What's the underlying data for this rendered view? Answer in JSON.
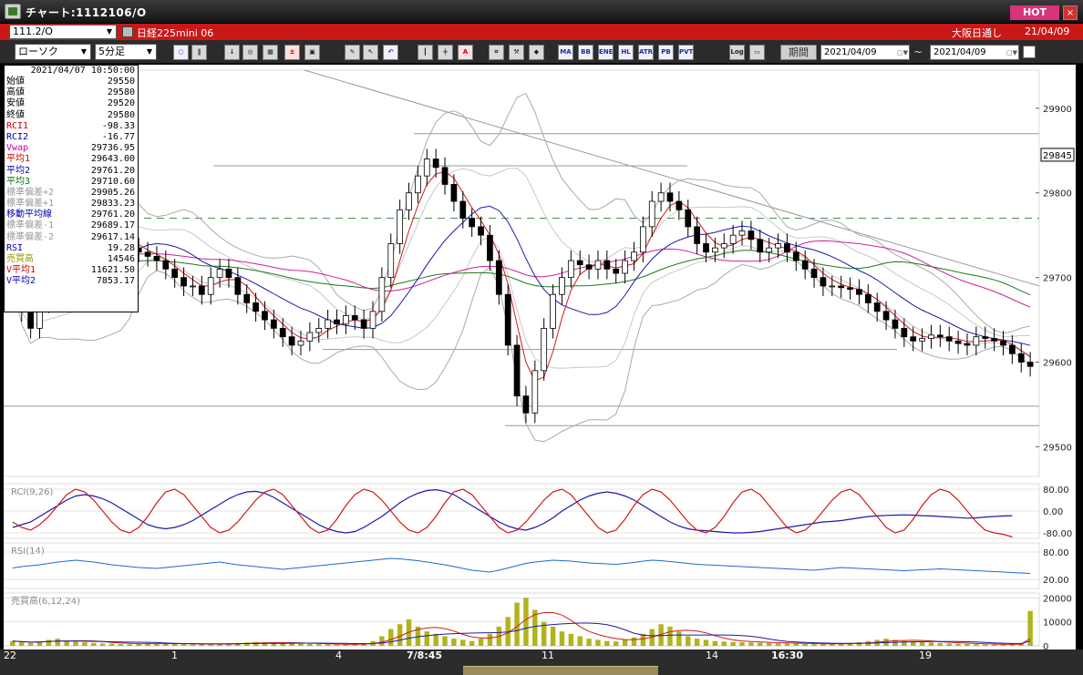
{
  "window": {
    "title": "チャート:1112106/O",
    "hot_label": "HOT",
    "close_label": "×"
  },
  "symbol_bar": {
    "symbol": "111.2/O",
    "instrument": "日経225mini 06",
    "session": "大阪日通し",
    "date_short": "21/04/09"
  },
  "toolbar": {
    "chart_type": "ローソク",
    "interval": "5分足",
    "buttons": [
      "MA",
      "BB",
      "ENE",
      "HL",
      "ATR",
      "PB",
      "PVT",
      "Log"
    ],
    "period_label": "期間",
    "date_from": "2021/04/09",
    "date_to": "2021/04/09",
    "tilde": "~"
  },
  "info": {
    "datetime": "2021/04/07  10:50:00",
    "rows": [
      {
        "label": "始値",
        "value": "29550",
        "color": "#000000"
      },
      {
        "label": "高値",
        "value": "29580",
        "color": "#000000"
      },
      {
        "label": "安値",
        "value": "29520",
        "color": "#000000"
      },
      {
        "label": "終値",
        "value": "29580",
        "color": "#000000"
      },
      {
        "label": "RCI1",
        "value": "-98.33",
        "color": "#cc0000"
      },
      {
        "label": "RCI2",
        "value": "-16.77",
        "color": "#0000aa"
      },
      {
        "label": "Vwap",
        "value": "29736.95",
        "color": "#cc00aa"
      },
      {
        "label": "平均1",
        "value": "29643.00",
        "color": "#cc0000"
      },
      {
        "label": "平均2",
        "value": "29761.20",
        "color": "#0000aa"
      },
      {
        "label": "平均3",
        "value": "29710.60",
        "color": "#007700"
      },
      {
        "label": "標準偏差+2",
        "value": "29905.26",
        "color": "#999999"
      },
      {
        "label": "標準偏差+1",
        "value": "29833.23",
        "color": "#999999"
      },
      {
        "label": "移動平均線",
        "value": "29761.20",
        "color": "#0000aa"
      },
      {
        "label": "標準偏差-1",
        "value": "29689.17",
        "color": "#999999"
      },
      {
        "label": "標準偏差-2",
        "value": "29617.14",
        "color": "#999999"
      },
      {
        "label": "RSI",
        "value": "19.28",
        "color": "#0000aa"
      },
      {
        "label": "売買高",
        "value": "14546",
        "color": "#999900"
      },
      {
        "label": "V平均1",
        "value": "11621.50",
        "color": "#cc0000"
      },
      {
        "label": "V平均2",
        "value": "7853.17",
        "color": "#0000aa"
      }
    ]
  },
  "axes": {
    "price_ticks": [
      "29900",
      "29800",
      "29700",
      "29600",
      "29500"
    ],
    "current_price": "29845",
    "rci_label": "RCI(9,26)",
    "rci_ticks": [
      "80.00",
      "0.00",
      "-80.00"
    ],
    "rsi_label": "RSI(14)",
    "rsi_ticks": [
      "80.00",
      "20.00"
    ],
    "vol_label": "売買高(6,12,24)",
    "vol_ticks": [
      "20000",
      "10000",
      "0"
    ],
    "x_ticks": [
      {
        "label": "22",
        "bold": false
      },
      {
        "label": "1",
        "bold": false
      },
      {
        "label": "4",
        "bold": false
      },
      {
        "label": "7/8:45",
        "bold": true
      },
      {
        "label": "11",
        "bold": false
      },
      {
        "label": "14",
        "bold": false
      },
      {
        "label": "16:30",
        "bold": true
      },
      {
        "label": "19",
        "bold": false
      }
    ]
  },
  "chart_data": {
    "type": "candlestick",
    "price_range": [
      29465,
      29945
    ],
    "close": [
      29690,
      29660,
      29640,
      29670,
      29700,
      29720,
      29730,
      29740,
      29760,
      29770,
      29760,
      29750,
      29740,
      29735,
      29730,
      29725,
      29720,
      29710,
      29700,
      29690,
      29690,
      29680,
      29700,
      29710,
      29700,
      29680,
      29670,
      29660,
      29650,
      29640,
      29630,
      29620,
      29625,
      29635,
      29640,
      29650,
      29645,
      29655,
      29650,
      29640,
      29660,
      29700,
      29740,
      29780,
      29800,
      29820,
      29840,
      29830,
      29810,
      29790,
      29770,
      29760,
      29750,
      29720,
      29680,
      29620,
      29560,
      29540,
      29590,
      29640,
      29680,
      29700,
      29720,
      29715,
      29710,
      29720,
      29710,
      29705,
      29720,
      29730,
      29760,
      29790,
      29800,
      29790,
      29780,
      29760,
      29740,
      29730,
      29735,
      29740,
      29750,
      29755,
      29745,
      29730,
      29735,
      29740,
      29730,
      29720,
      29710,
      29700,
      29690,
      29690,
      29688,
      29686,
      29680,
      29670,
      29660,
      29650,
      29640,
      29630,
      29625,
      29628,
      29632,
      29630,
      29625,
      29622,
      29620,
      29630,
      29628,
      29625,
      29620,
      29610,
      29600,
      29595
    ],
    "rci1": [
      -40,
      -60,
      -70,
      -50,
      -20,
      20,
      60,
      80,
      70,
      40,
      0,
      -40,
      -70,
      -80,
      -60,
      -20,
      30,
      70,
      80,
      60,
      20,
      -20,
      -60,
      -80,
      -70,
      -40,
      0,
      40,
      70,
      80,
      60,
      20,
      -20,
      -60,
      -80,
      -70,
      -30,
      20,
      60,
      80,
      70,
      40,
      0,
      -40,
      -70,
      -80,
      -60,
      -20,
      30,
      70,
      80,
      60,
      20,
      -20,
      -60,
      -80,
      -70,
      -40,
      0,
      40,
      70,
      80,
      60,
      20,
      -20,
      -60,
      -80,
      -70,
      -30,
      20,
      60,
      80,
      70,
      40,
      0,
      -40,
      -70,
      -80,
      -60,
      -20,
      30,
      70,
      80,
      60,
      20,
      -20,
      -60,
      -80,
      -70,
      -40,
      0,
      40,
      70,
      80,
      60,
      20,
      -20,
      -60,
      -80,
      -70,
      -30,
      20,
      60,
      80,
      70,
      40,
      0,
      -40,
      -70,
      -80,
      -85,
      -95
    ],
    "rci2": [
      -60,
      -50,
      -40,
      -20,
      0,
      20,
      40,
      55,
      60,
      55,
      45,
      30,
      10,
      -10,
      -30,
      -50,
      -60,
      -65,
      -60,
      -50,
      -35,
      -15,
      5,
      25,
      45,
      60,
      70,
      72,
      65,
      50,
      30,
      10,
      -10,
      -30,
      -50,
      -65,
      -75,
      -80,
      -75,
      -60,
      -40,
      -20,
      5,
      30,
      50,
      65,
      75,
      78,
      72,
      60,
      40,
      20,
      0,
      -20,
      -40,
      -55,
      -65,
      -70,
      -60,
      -45,
      -25,
      0,
      20,
      40,
      55,
      65,
      70,
      65,
      55,
      40,
      20,
      0,
      -20,
      -40,
      -55,
      -65,
      -70,
      -72,
      -75,
      -78,
      -80,
      -80,
      -78,
      -75,
      -70,
      -65,
      -60,
      -55,
      -50,
      -45,
      -40,
      -38,
      -35,
      -30,
      -25,
      -20,
      -18,
      -16,
      -15,
      -14,
      -15,
      -17,
      -18,
      -20,
      -22,
      -24,
      -26,
      -25,
      -22,
      -20,
      -18,
      -17
    ],
    "rsi": [
      45,
      48,
      50,
      52,
      55,
      58,
      60,
      62,
      60,
      58,
      55,
      52,
      50,
      48,
      46,
      45,
      44,
      46,
      48,
      50,
      52,
      54,
      56,
      58,
      55,
      52,
      50,
      48,
      46,
      44,
      42,
      44,
      46,
      48,
      50,
      52,
      54,
      56,
      58,
      60,
      62,
      64,
      66,
      65,
      63,
      61,
      58,
      55,
      52,
      48,
      44,
      40,
      38,
      36,
      40,
      45,
      50,
      55,
      58,
      60,
      62,
      61,
      60,
      58,
      56,
      55,
      54,
      53,
      55,
      57,
      60,
      62,
      61,
      59,
      57,
      55,
      53,
      52,
      51,
      50,
      49,
      48,
      47,
      46,
      45,
      44,
      43,
      42,
      41,
      40,
      42,
      44,
      46,
      45,
      44,
      43,
      42,
      41,
      40,
      39,
      40,
      41,
      42,
      43,
      42,
      41,
      40,
      39,
      38,
      37,
      36,
      35,
      34,
      33
    ],
    "volume": [
      2000,
      1500,
      1200,
      1800,
      2500,
      3000,
      2200,
      1800,
      1500,
      1200,
      1000,
      900,
      800,
      700,
      900,
      1200,
      1000,
      900,
      800,
      700,
      600,
      700,
      800,
      900,
      1000,
      1200,
      1400,
      1600,
      1500,
      1300,
      1200,
      1000,
      900,
      800,
      700,
      600,
      500,
      600,
      800,
      1200,
      2000,
      4000,
      7000,
      9000,
      11000,
      8000,
      6000,
      5000,
      4000,
      3000,
      2500,
      2000,
      3000,
      5000,
      8000,
      12000,
      18000,
      20000,
      15000,
      10000,
      8000,
      6000,
      5000,
      4000,
      3000,
      2500,
      2000,
      1800,
      2500,
      3500,
      5000,
      7000,
      9000,
      8000,
      6000,
      4000,
      3000,
      2500,
      2000,
      1800,
      1600,
      1500,
      1400,
      1300,
      1200,
      1100,
      1000,
      900,
      800,
      700,
      800,
      900,
      1000,
      1200,
      1500,
      2000,
      2500,
      3000,
      2500,
      2000,
      1800,
      1600,
      1400,
      1200,
      1000,
      900,
      800,
      700,
      600,
      500,
      600,
      800,
      1200,
      14546
    ]
  }
}
